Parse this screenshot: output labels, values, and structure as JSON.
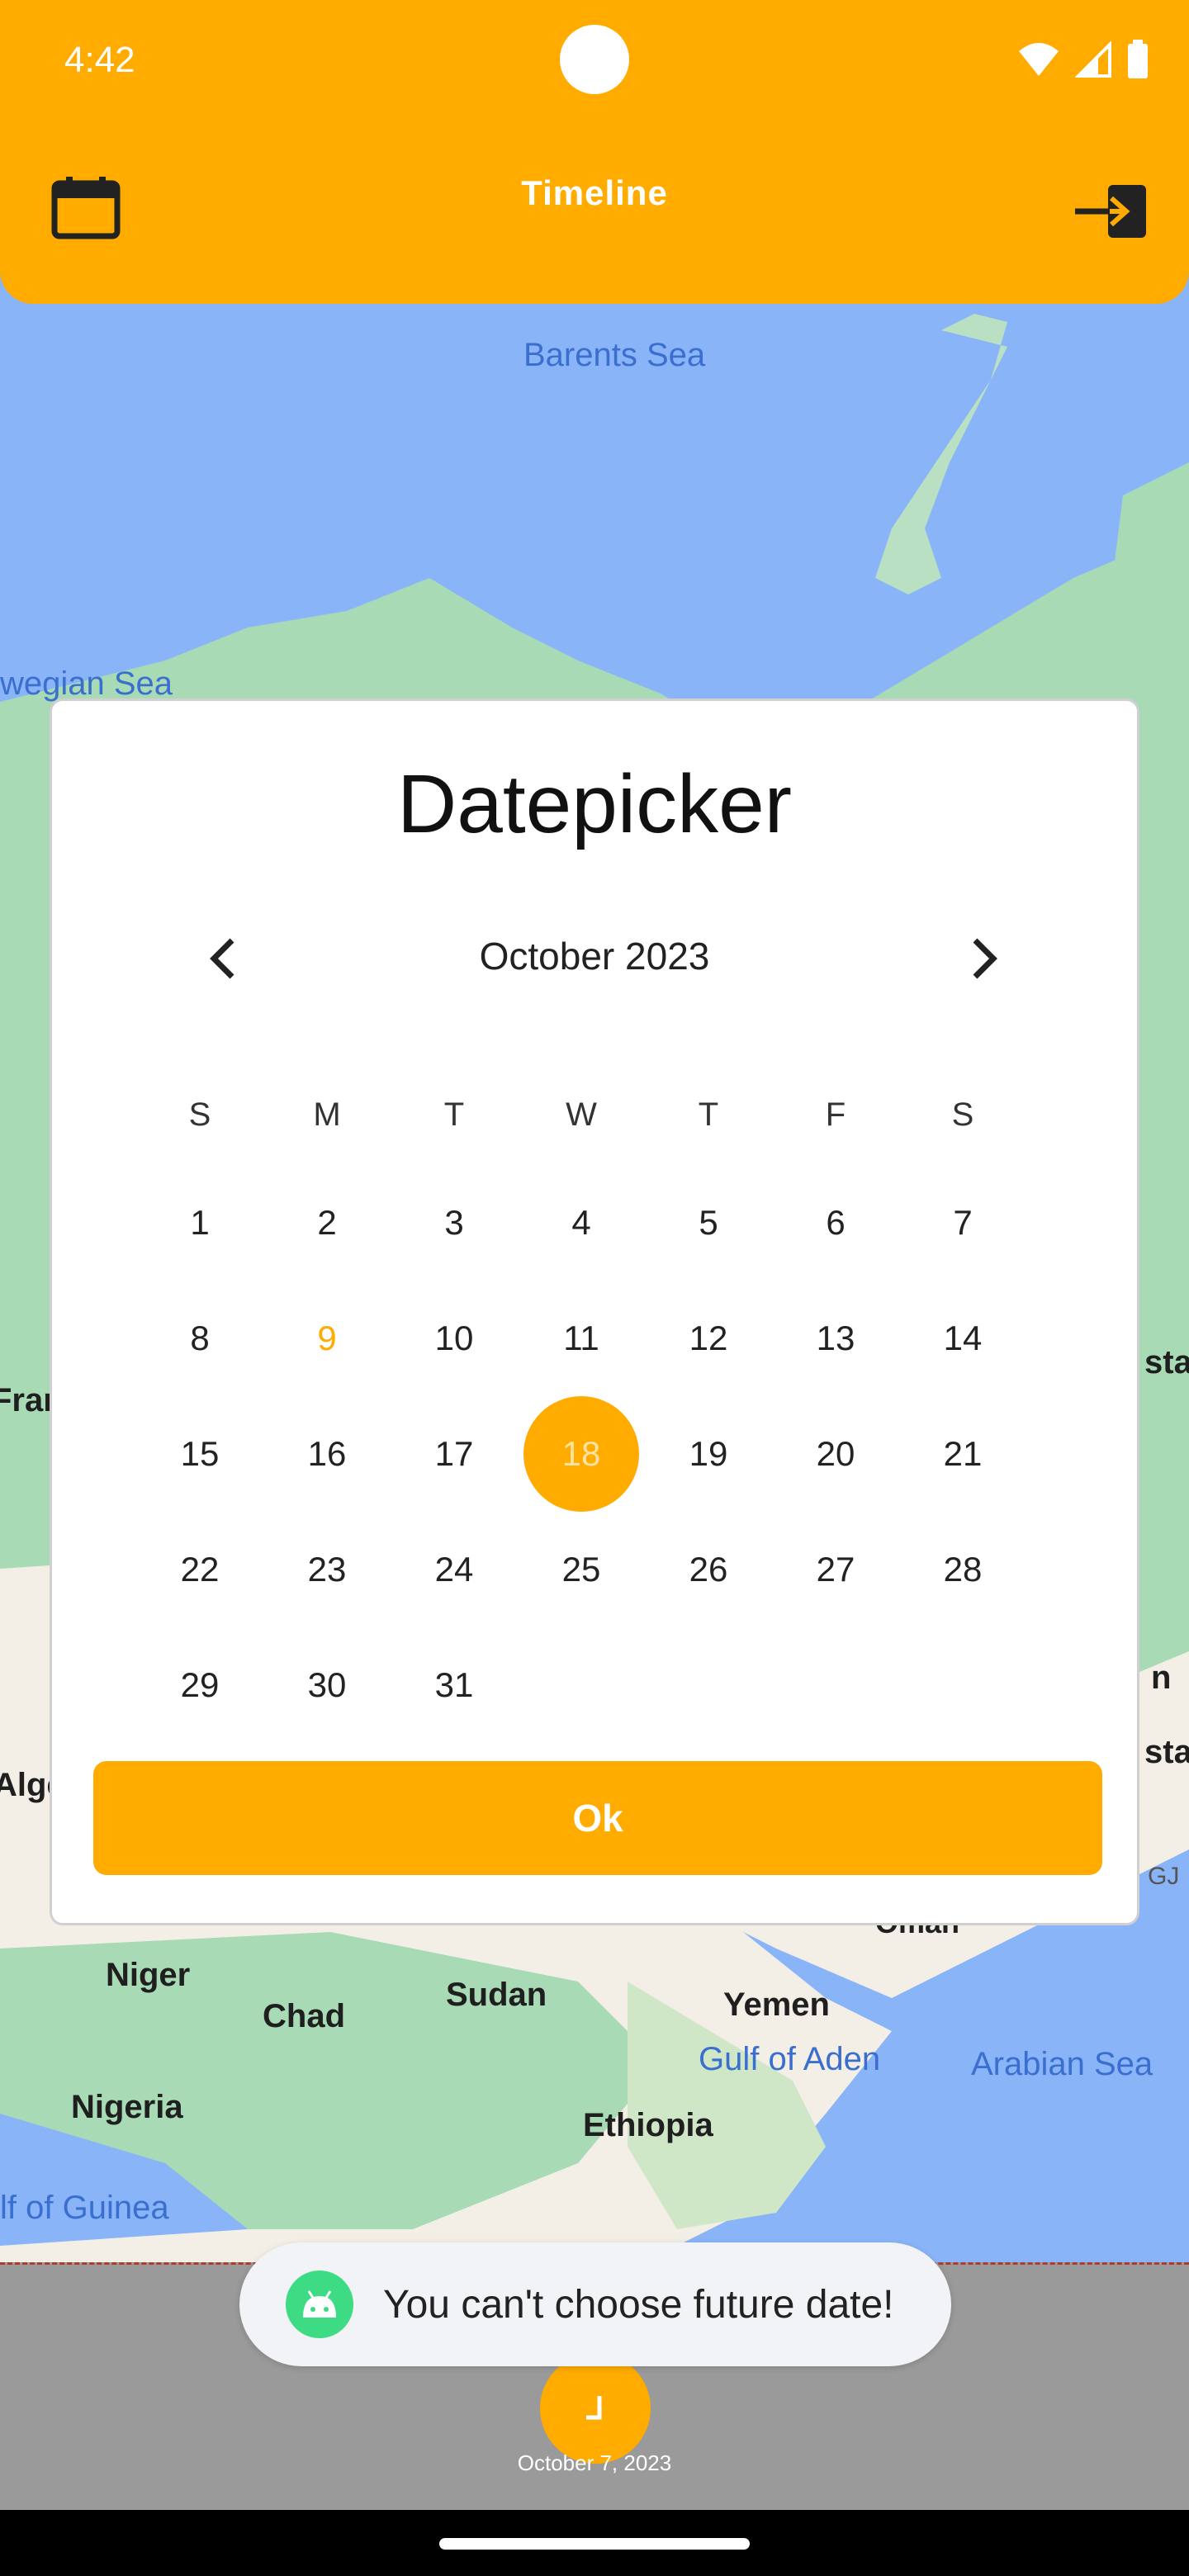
{
  "status_bar": {
    "time": "4:42"
  },
  "header": {
    "title": "Timeline"
  },
  "map": {
    "labels": {
      "barents_sea": "Barents Sea",
      "norwegian_sea": "wegian Sea",
      "fran": "Fran",
      "alge": "Alge",
      "stan1": "stan",
      "n": "n",
      "stan2": "stan",
      "gj": "GJ",
      "oman": "Oman",
      "niger": "Niger",
      "chad": "Chad",
      "sudan": "Sudan",
      "yemen": "Yemen",
      "gulf_of_aden": "Gulf of Aden",
      "arabian_sea": "Arabian Sea",
      "nigeria": "Nigeria",
      "ethiopia": "Ethiopia",
      "gulf_of_guinea": "lf of Guinea"
    }
  },
  "datepicker": {
    "title": "Datepicker",
    "month_label": "October 2023",
    "day_headers": [
      "S",
      "M",
      "T",
      "W",
      "T",
      "F",
      "S"
    ],
    "weeks": [
      [
        "1",
        "2",
        "3",
        "4",
        "5",
        "6",
        "7"
      ],
      [
        "8",
        "9",
        "10",
        "11",
        "12",
        "13",
        "14"
      ],
      [
        "15",
        "16",
        "17",
        "18",
        "19",
        "20",
        "21"
      ],
      [
        "22",
        "23",
        "24",
        "25",
        "26",
        "27",
        "28"
      ],
      [
        "29",
        "30",
        "31",
        "",
        "",
        "",
        ""
      ]
    ],
    "today": "9",
    "selected": "18",
    "ok_label": "Ok"
  },
  "timeline": {
    "date": "October 7, 2023"
  },
  "toast": {
    "message": "You can't choose future date!"
  },
  "colors": {
    "accent": "#ffab00",
    "map_water": "#8ab4f8",
    "land": "#a8dab5",
    "toast_icon": "#3ddc84"
  }
}
